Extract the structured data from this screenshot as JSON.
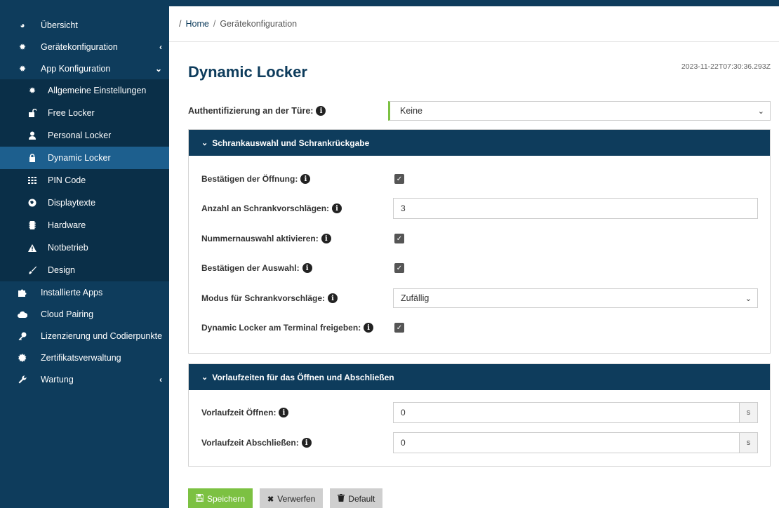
{
  "sidebar": {
    "items": [
      {
        "label": "Übersicht",
        "icon": "pie-chart-icon",
        "glyph": "◕"
      },
      {
        "label": "Gerätekonfiguration",
        "icon": "gear-icon",
        "glyph": "✹",
        "chevron": "‹"
      },
      {
        "label": "App Konfiguration",
        "icon": "gears-icon",
        "glyph": "✹",
        "chevron": "⌄"
      }
    ],
    "subitems": [
      {
        "label": "Allgemeine Einstellungen",
        "icon": "gear-icon",
        "glyph": "✹"
      },
      {
        "label": "Free Locker",
        "icon": "unlock-icon",
        "glyph": "🔓"
      },
      {
        "label": "Personal Locker",
        "icon": "user-icon",
        "glyph": "👤"
      },
      {
        "label": "Dynamic Locker",
        "icon": "lock-icon",
        "glyph": "🔒"
      },
      {
        "label": "PIN Code",
        "icon": "grid-icon",
        "glyph": "▦"
      },
      {
        "label": "Displaytexte",
        "icon": "globe-icon",
        "glyph": "◍"
      },
      {
        "label": "Hardware",
        "icon": "chip-icon",
        "glyph": "■"
      },
      {
        "label": "Notbetrieb",
        "icon": "warning-icon",
        "glyph": "▲"
      },
      {
        "label": "Design",
        "icon": "brush-icon",
        "glyph": "✎"
      }
    ],
    "bottom_items": [
      {
        "label": "Installierte Apps",
        "icon": "puzzle-icon",
        "glyph": "✚"
      },
      {
        "label": "Cloud Pairing",
        "icon": "cloud-icon",
        "glyph": "☁"
      },
      {
        "label": "Lizenzierung und Codierpunkte",
        "icon": "key-icon",
        "glyph": "⚷"
      },
      {
        "label": "Zertifikatsverwaltung",
        "icon": "certificate-icon",
        "glyph": "✸"
      },
      {
        "label": "Wartung",
        "icon": "wrench-icon",
        "glyph": "🔧",
        "chevron": "‹"
      }
    ]
  },
  "breadcrumb": {
    "sep": "/",
    "home": "Home",
    "current": "Gerätekonfiguration"
  },
  "page": {
    "title": "Dynamic Locker",
    "timestamp": "2023-11-22T07:30:36.293Z"
  },
  "auth": {
    "label": "Authentifizierung an der Türe:",
    "value": "Keine"
  },
  "panel1": {
    "title": "Schrankauswahl und Schrankrückgabe",
    "rows": [
      {
        "label": "Bestätigen der Öffnung:",
        "type": "checkbox",
        "checked": true
      },
      {
        "label": "Anzahl an Schrankvorschlägen:",
        "type": "input",
        "value": "3"
      },
      {
        "label": "Nummernauswahl aktivieren:",
        "type": "checkbox",
        "checked": true
      },
      {
        "label": "Bestätigen der Auswahl:",
        "type": "checkbox",
        "checked": true
      },
      {
        "label": "Modus für Schrankvorschläge:",
        "type": "select",
        "value": "Zufällig"
      },
      {
        "label": "Dynamic Locker am Terminal freigeben:",
        "type": "checkbox",
        "checked": true
      }
    ]
  },
  "panel2": {
    "title": "Vorlaufzeiten für das Öffnen und Abschließen",
    "rows": [
      {
        "label": "Vorlaufzeit Öffnen:",
        "value": "0",
        "unit": "s"
      },
      {
        "label": "Vorlaufzeit Abschließen:",
        "value": "0",
        "unit": "s"
      }
    ]
  },
  "buttons": {
    "save": "Speichern",
    "discard": "Verwerfen",
    "default": "Default"
  }
}
